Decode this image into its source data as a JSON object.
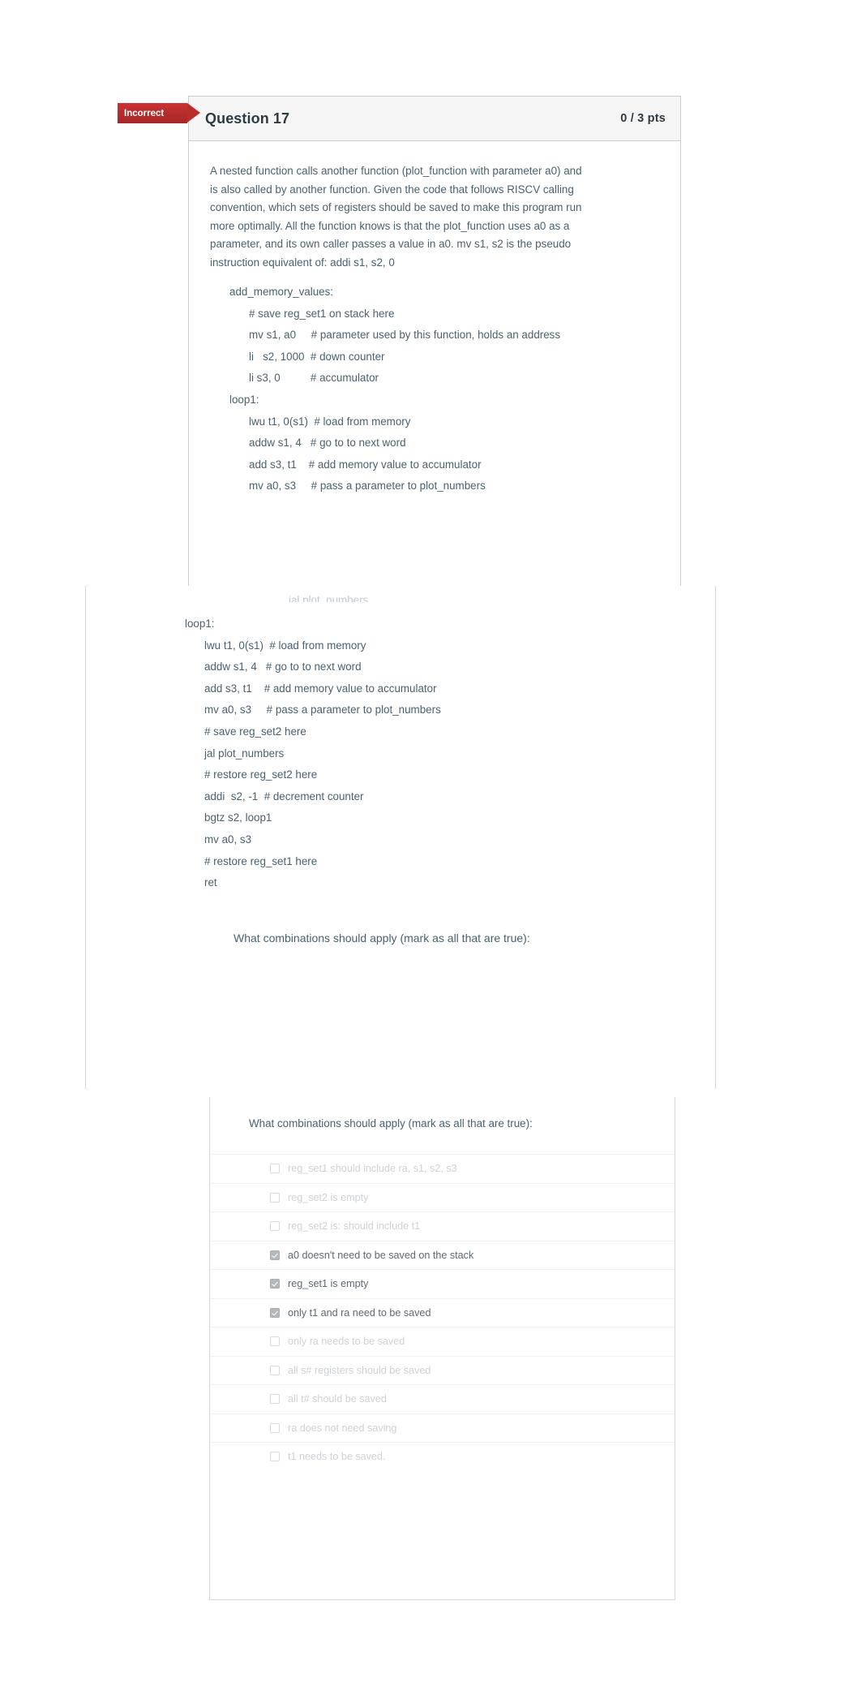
{
  "question": {
    "status_badge": "Incorrect",
    "title": "Question 17",
    "points": "0 / 3 pts",
    "prompt_lines": [
      "A nested function calls another function (plot_function with parameter a0) and",
      "is also called by another function.  Given the code that follows  RISCV calling",
      "convention, which sets of registers should be saved to make this program run",
      "more optimally.   All the function knows  is that the plot_function uses a0 as a",
      "parameter, and its own caller passes a value in a0.  mv s1, s2    is the pseudo",
      "instruction equivalent of:  addi s1, s2, 0"
    ]
  },
  "code_part_one": [
    {
      "indent": 1,
      "text": "add_memory_values:"
    },
    {
      "indent": 2,
      "text": "# save reg_set1 on stack here"
    },
    {
      "indent": 2,
      "text": "mv s1, a0     # parameter used by this function, holds an address"
    },
    {
      "indent": 2,
      "text": "li   s2, 1000  # down counter"
    },
    {
      "indent": 2,
      "text": "li s3, 0          # accumulator"
    },
    {
      "indent": 1,
      "text": "loop1:"
    },
    {
      "indent": 2,
      "text": "lwu t1, 0(s1)  # load from memory"
    },
    {
      "indent": 2,
      "text": "addw s1, 4   # go to to next word"
    },
    {
      "indent": 2,
      "text": "add s3, t1    # add memory value to accumulator"
    },
    {
      "indent": 2,
      "text": "mv a0, s3     # pass a parameter to plot_numbers"
    }
  ],
  "code_part_two": [
    {
      "indent": 1,
      "text": "loop1:"
    },
    {
      "indent": 2,
      "text": "lwu t1, 0(s1)  # load from memory"
    },
    {
      "indent": 2,
      "text": "addw s1, 4   # go to to next word"
    },
    {
      "indent": 2,
      "text": "add s3, t1    # add memory value to accumulator"
    },
    {
      "indent": 2,
      "text": "mv a0, s3     # pass a parameter to plot_numbers"
    },
    {
      "indent": 2,
      "text": "# save reg_set2 here"
    },
    {
      "indent": 2,
      "text": "jal plot_numbers"
    },
    {
      "indent": 2,
      "text": "# restore reg_set2 here"
    },
    {
      "indent": 2,
      "text": "addi  s2, -1  # decrement counter"
    },
    {
      "indent": 2,
      "text": "bgtz s2, loop1"
    },
    {
      "indent": 2,
      "text": "mv a0, s3"
    },
    {
      "indent": 2,
      "text": "# restore reg_set1 here"
    },
    {
      "indent": 2,
      "text": "ret"
    }
  ],
  "clipped_code_fragment": "jal plot_numbers",
  "answers_prompt": "What combinations should apply (mark as all that are true):",
  "answers": [
    {
      "label": "reg_set1 should include ra, s1, s2, s3",
      "selected": false
    },
    {
      "label": "reg_set2 is empty",
      "selected": false
    },
    {
      "label": "reg_set2 is: should include t1",
      "selected": false
    },
    {
      "label": "a0 doesn't need to be saved on the stack",
      "selected": true
    },
    {
      "label": "reg_set1 is empty",
      "selected": true
    },
    {
      "label": "only t1 and ra need to be saved",
      "selected": true
    },
    {
      "label": "only ra needs to be saved",
      "selected": false
    },
    {
      "label": "all s# registers should be saved",
      "selected": false
    },
    {
      "label": "all t# should be saved",
      "selected": false
    },
    {
      "label": "ra does not need saving",
      "selected": false
    },
    {
      "label": "t1 needs to be saved.",
      "selected": false
    }
  ],
  "colors": {
    "incorrect_badge": "#b32c2c",
    "text": "#4a6270",
    "title": "#2d3b45",
    "muted_option": "#cdd2d6",
    "border": "#c7cdd1"
  }
}
